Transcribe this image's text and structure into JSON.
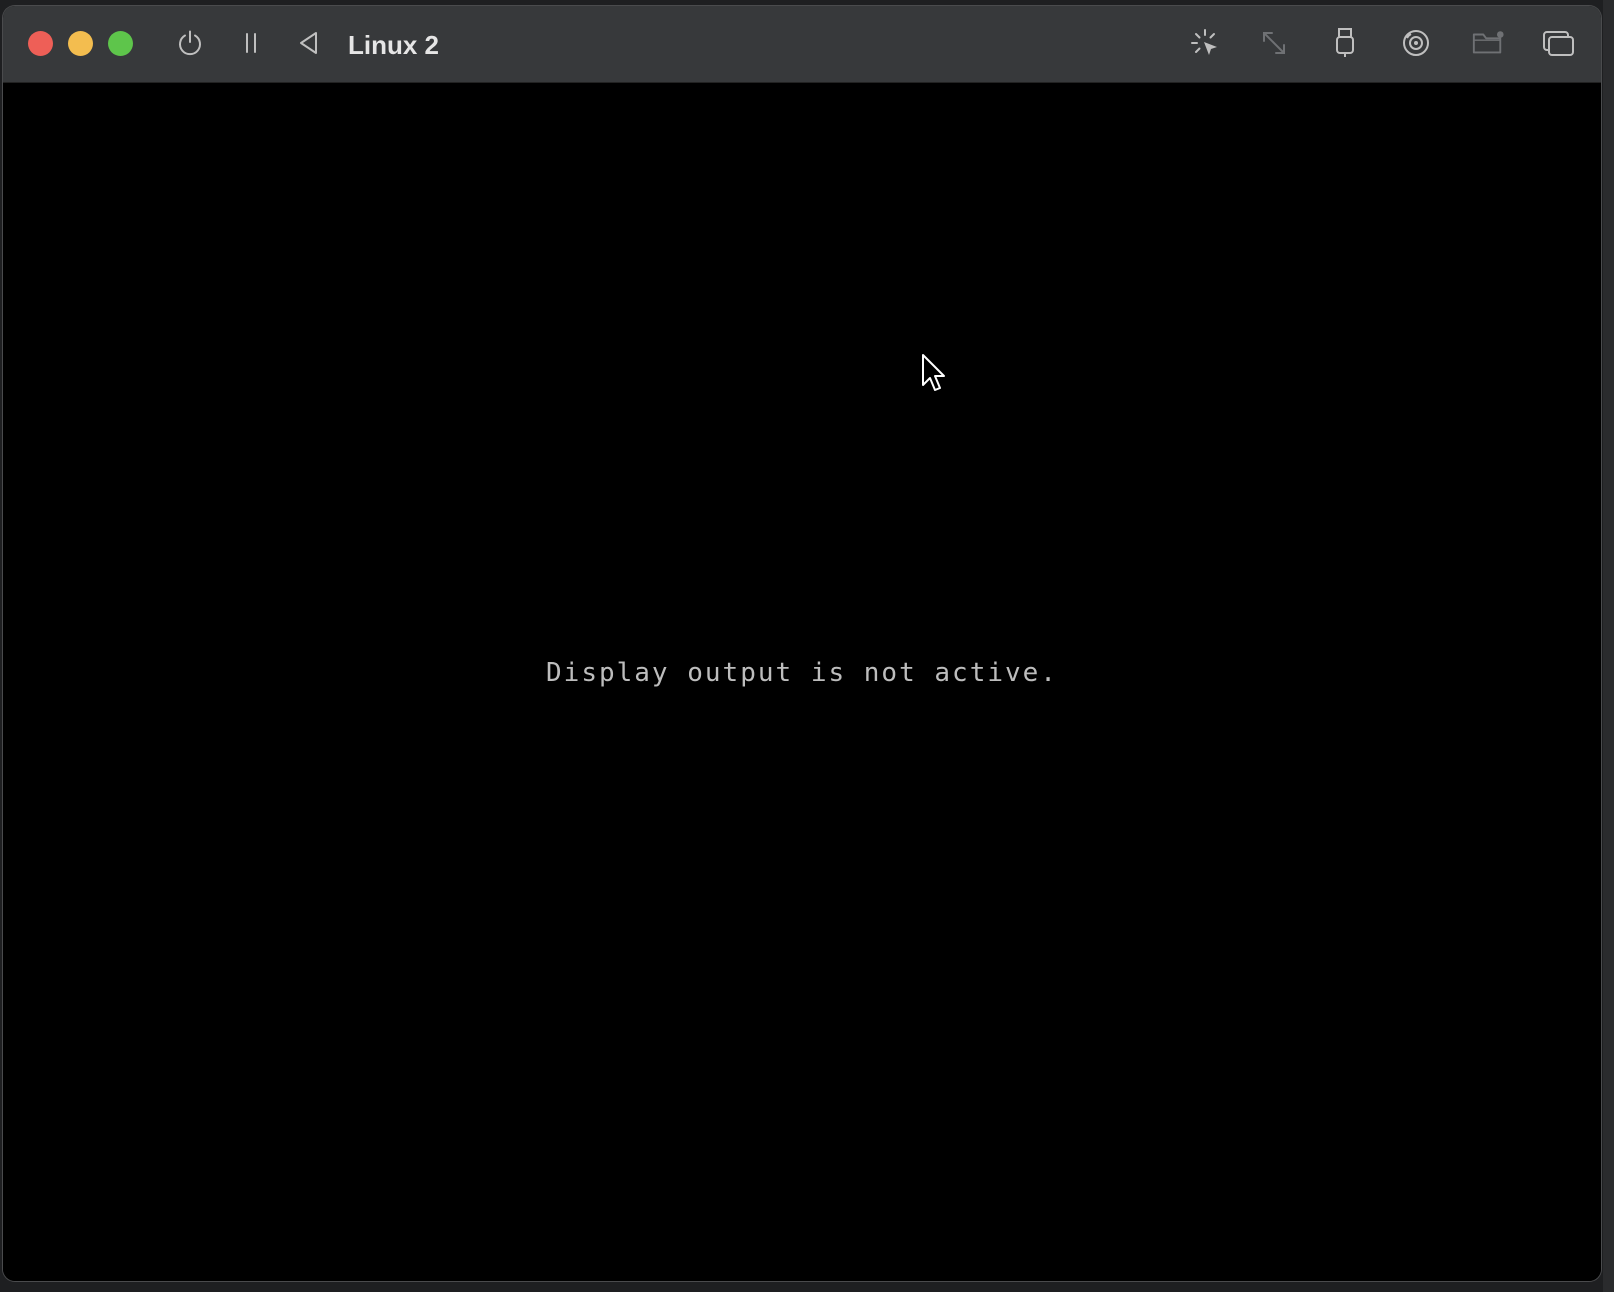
{
  "window": {
    "title": "Linux 2"
  },
  "toolbar": {
    "buttons": [
      {
        "name": "power-button",
        "icon": "power-icon"
      },
      {
        "name": "pause-button",
        "icon": "pause-icon"
      },
      {
        "name": "back-button",
        "icon": "triangle-left-icon"
      }
    ],
    "right_buttons": [
      {
        "name": "capture-input-button",
        "icon": "cursor-capture-icon"
      },
      {
        "name": "resize-button",
        "icon": "resize-arrows-icon"
      },
      {
        "name": "usb-button",
        "icon": "usb-icon"
      },
      {
        "name": "disk-button",
        "icon": "disc-icon"
      },
      {
        "name": "shared-folder-button",
        "icon": "folder-icon"
      },
      {
        "name": "windows-button",
        "icon": "windows-icon"
      }
    ]
  },
  "display": {
    "message": "Display output is not active."
  },
  "colors": {
    "close": "#ee5f57",
    "minimize": "#f3bd4f",
    "zoom": "#5ec54b",
    "titlebar": "#37393b",
    "display_bg": "#000000",
    "message_text": "#bdbdbd"
  }
}
